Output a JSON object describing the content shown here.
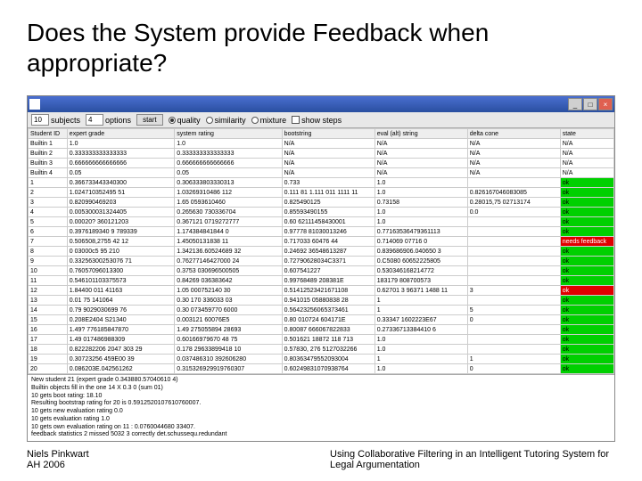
{
  "slide": {
    "title": "Does the System provide Feedback when appropriate?"
  },
  "toolbar": {
    "subjects_value": "10",
    "subjects_label": "subjects",
    "options_value": "4",
    "options_label": "options",
    "start_label": "start",
    "radio_quality": "quality",
    "radio_similarity": "similarity",
    "radio_mixture": "mixture",
    "show_steps_label": "show steps"
  },
  "headers": {
    "c0": "Student ID",
    "c1": "expert grade",
    "c2": "system rating",
    "c3": "bootstring",
    "c4": "eval (alt) string",
    "c5": "delta cone",
    "c6": "state"
  },
  "rows": [
    {
      "id": "Builtin 1",
      "eg": "1.0",
      "sr": "1.0",
      "bs": "N/A",
      "ev": "N/A",
      "de": "N/A",
      "st": "N/A",
      "cls": ""
    },
    {
      "id": "Builtin 2",
      "eg": "0.333333333333333",
      "sr": "0.333333333333333",
      "bs": "N/A",
      "ev": "N/A",
      "de": "N/A",
      "st": "N/A",
      "cls": ""
    },
    {
      "id": "Builtin 3",
      "eg": "0.666666666666666",
      "sr": "0.666666666666666",
      "bs": "N/A",
      "ev": "N/A",
      "de": "N/A",
      "st": "N/A",
      "cls": ""
    },
    {
      "id": "Builtin 4",
      "eg": "0.05",
      "sr": "0.05",
      "bs": "N/A",
      "ev": "N/A",
      "de": "N/A",
      "st": "N/A",
      "cls": ""
    },
    {
      "id": "1",
      "eg": "0.366733443340300",
      "sr": "0.306333803330313",
      "bs": "0.733",
      "ev": "1.0",
      "de": "",
      "st": "ok",
      "cls": "state-ok"
    },
    {
      "id": "2",
      "eg": "1.024710352495 51",
      "sr": "1.03269310486 112",
      "bs": "0.111 81 1.111 011 1111 11",
      "ev": "1.0",
      "de": "0.826167046083085",
      "st": "ok",
      "cls": "state-ok"
    },
    {
      "id": "3",
      "eg": "0.820990469203",
      "sr": "1.65 0593610460",
      "bs": "0.825490125",
      "ev": "0.73158",
      "de": "0.28015,75 02713174",
      "st": "ok",
      "cls": "state-ok"
    },
    {
      "id": "4",
      "eg": "0.005300031324405",
      "sr": "0.265630 730336704",
      "bs": "0.85593490155",
      "ev": "1.0",
      "de": "0.0",
      "st": "ok",
      "cls": "state-ok"
    },
    {
      "id": "5",
      "eg": "0.00020? 360121203",
      "sr": "0.367121 0719272777",
      "bs": "0.60 62111458430001",
      "ev": "1.0",
      "de": "",
      "st": "ok",
      "cls": "state-ok"
    },
    {
      "id": "6",
      "eg": "0.3976189340 9 789339",
      "sr": "1.174384841844 0",
      "bs": "0.97778 81030013246",
      "ev": "0.77163536479361113",
      "de": "",
      "st": "ok",
      "cls": "state-ok"
    },
    {
      "id": "7",
      "eg": "0.506508,2755 42 12",
      "sr": "1.45050131838 11",
      "bs": "0.717033 60476 44",
      "ev": "0.714069 07716 0",
      "de": "",
      "st": "needs feedback",
      "cls": "state-need"
    },
    {
      "id": "8",
      "eg": "0 03000c5 95 210",
      "sr": "1.342136.60524689 32",
      "bs": "0.24692 36548613287",
      "ev": "0.839686906.040650 3",
      "de": "",
      "st": "ok",
      "cls": "state-ok"
    },
    {
      "id": "9",
      "eg": "0.33256300253076 71",
      "sr": "0.76277146427000 24",
      "bs": "0.72790628034C3371",
      "ev": "0.C5080 60652225805",
      "de": "",
      "st": "ok",
      "cls": "state-ok"
    },
    {
      "id": "10",
      "eg": "0.76057096013300",
      "sr": "0.3753 030696500505",
      "bs": "0.607541227",
      "ev": "0.530346168214772",
      "de": "",
      "st": "ok",
      "cls": "state-ok"
    },
    {
      "id": "11",
      "eg": "0.546101103375573",
      "sr": "0.84269 036383642",
      "bs": "0.99768489 208381E",
      "ev": "183179 808700573",
      "de": "",
      "st": "ok",
      "cls": "state-ok"
    },
    {
      "id": "12",
      "eg": "1.84400 011 41163",
      "sr": "1.05 000752140 30",
      "bs": "0.51412523421671108",
      "ev": "0.62701 3 96371 1488 11",
      "de": "3",
      "st": "ok",
      "cls": "state-need"
    },
    {
      "id": "13",
      "eg": "0.01 75 141064",
      "sr": "0.30 170 336033 03",
      "bs": "0.941015 05880838 28",
      "ev": "1",
      "de": "",
      "st": "ok",
      "cls": "state-ok"
    },
    {
      "id": "14",
      "eg": "0.79 9029030699 76",
      "sr": "0.30 073459770 6000",
      "bs": "0.56423256065373461",
      "ev": "1",
      "de": "5",
      "st": "ok",
      "cls": "state-ok"
    },
    {
      "id": "15",
      "eg": "0.208E2404 S21340",
      "sr": "0.003121 60076E5",
      "bs": "0.80 010724 604171E",
      "ev": "0.33347 1602223E67",
      "de": "0",
      "st": "ok",
      "cls": "state-ok"
    },
    {
      "id": "16",
      "eg": "1.49? 776185847870",
      "sr": "1.49 275055894 28693",
      "bs": "0.80087 666067822833",
      "ev": "0.27336713384410 6",
      "de": "",
      "st": "ok",
      "cls": "state-ok"
    },
    {
      "id": "17",
      "eg": "1.49 017486988309",
      "sr": "0.60166979670 48 75",
      "bs": "0.501621 18872 118 713",
      "ev": "1.0",
      "de": "",
      "st": "ok",
      "cls": "state-ok"
    },
    {
      "id": "18",
      "eg": "0.822282206 2047 303 29",
      "sr": "0.178 29633899418 10",
      "bs": "0.57830, 276 5127032266",
      "ev": "1.0",
      "de": "",
      "st": "ok",
      "cls": "state-ok"
    },
    {
      "id": "19",
      "eg": "0.30723256 459E00 39",
      "sr": "0.037486310 392606280",
      "bs": "0.80363479552093004",
      "ev": "1",
      "de": "1",
      "st": "ok",
      "cls": "state-ok"
    },
    {
      "id": "20",
      "eg": "0.086203E.042561262",
      "sr": "0.315326929919760307",
      "bs": "0.60249831070938764",
      "ev": "1.0",
      "de": "0",
      "st": "ok",
      "cls": "state-ok"
    }
  ],
  "log": {
    "l1": "New student 21 (expert grade 0.343880.57040610 4)",
    "l2": "Builtin objects fill in the one 14 X 0.3 0 (sum 01)",
    "l3": "10 gets boot rating: 18.10",
    "l4": "Resulting bootstrap rating for 20 is 0.5912520107610760007.",
    "l5": "10 gets new evaluation rating 0.0",
    "l6": "10 gets evaluation rating 1.0",
    "l7": "10 gets own evaluation rating on 11 : 0.0760044680 33407.",
    "l8": "feedback statistics 2 missed 5032 3 correctly det.schussequ.redundant"
  },
  "footer": {
    "left1": "Niels Pinkwart",
    "left2": "AH 2006",
    "right": "Using Collaborative Filtering in an Intelligent Tutoring System for Legal Argumentation"
  }
}
